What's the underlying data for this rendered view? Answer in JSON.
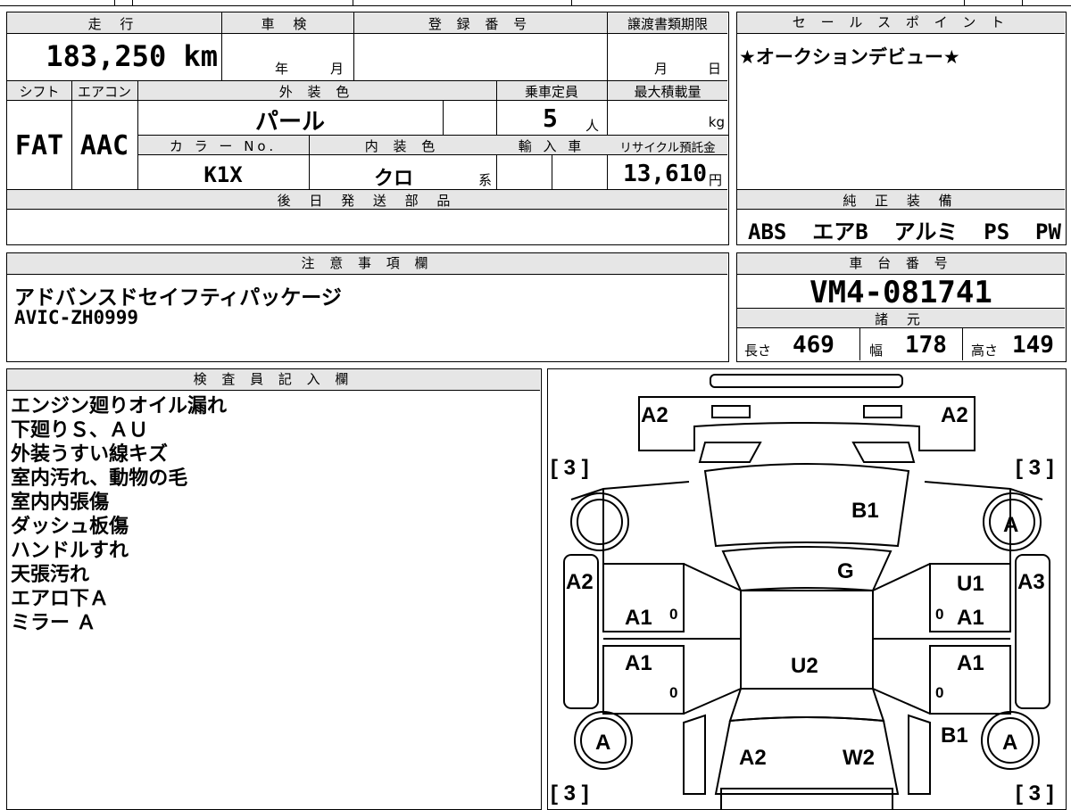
{
  "top": {
    "h_mileage": "走 行",
    "mileage": "183,250 km",
    "h_shaken": "車 検",
    "shaken_year": "年",
    "shaken_month": "月",
    "h_reg": "登 録 番 号",
    "h_transfer": "譲渡書類期限",
    "transfer_month": "月",
    "transfer_day": "日",
    "h_shift": "シフト",
    "shift": "FAT",
    "h_ac": "エアコン",
    "ac": "AAC",
    "h_color": "外 装 色",
    "color": "パール",
    "h_capacity": "乗車定員",
    "capacity": "5",
    "capacity_unit": "人",
    "h_load": "最大積載量",
    "load_unit": "kg",
    "h_color_no": "カ ラ ー No.",
    "color_no": "K1X",
    "h_interior": "内 装 色",
    "interior": "クロ",
    "interior_suffix": "系",
    "h_import": "輸 入 車",
    "h_recycle": "リサイクル預託金",
    "recycle": "13,610",
    "recycle_unit": "円",
    "h_parts": "後 日 発 送 部 品"
  },
  "sales": {
    "header": "セ ー ル ス ポ イ ン ト",
    "text": "★オークションデビュー★"
  },
  "equipment": {
    "header": "純 正 装 備",
    "text": "ABS  エアB  アルミ  PS  PW"
  },
  "notes": {
    "header": "注 意 事 項 欄",
    "line1": "アドバンスドセイフティパッケージ",
    "line2": "AVIC-ZH0999"
  },
  "chassis": {
    "header": "車 台 番 号",
    "number": "VM4-081741"
  },
  "specs": {
    "header": "諸 元",
    "length_label": "長さ",
    "length": "469",
    "width_label": "幅",
    "width": "178",
    "height_label": "高さ",
    "height": "149"
  },
  "inspector": {
    "header": "検 査 員 記 入 欄",
    "lines": [
      "エンジン廻りオイル漏れ",
      "下廻りＳ、ＡＵ",
      "外装うすい線キズ",
      "室内汚れ、動物の毛",
      "室内内張傷",
      "ダッシュ板傷",
      "ハンドルすれ",
      "天張汚れ",
      "エアロ下Ａ",
      "ミラー Ａ"
    ]
  },
  "diagram": {
    "marks": {
      "front_left_a2": "A2",
      "front_right_a2": "A2",
      "bracket_tl": "[ 3 ]",
      "bracket_tr": "[ 3 ]",
      "bracket_bl": "[ 3 ]",
      "bracket_br": "[ 3 ]",
      "hood": "B1",
      "front_right_wheel": "A",
      "windshield": "G",
      "left_fender": "A2",
      "right_fender": "A3",
      "right_front_door_u1": "U1",
      "left_front_door": "A1",
      "right_front_door": "A1",
      "left_rear_door": "A1",
      "right_rear_door": "A1",
      "roof": "U2",
      "left_rear_wheel": "A",
      "right_rear_wheel": "A",
      "right_rear_quarter": "B1",
      "trunk_left": "A2",
      "trunk_right": "W2",
      "zero_lf": "0",
      "zero_rf": "0",
      "zero_lr": "0",
      "zero_rr": "0"
    }
  }
}
